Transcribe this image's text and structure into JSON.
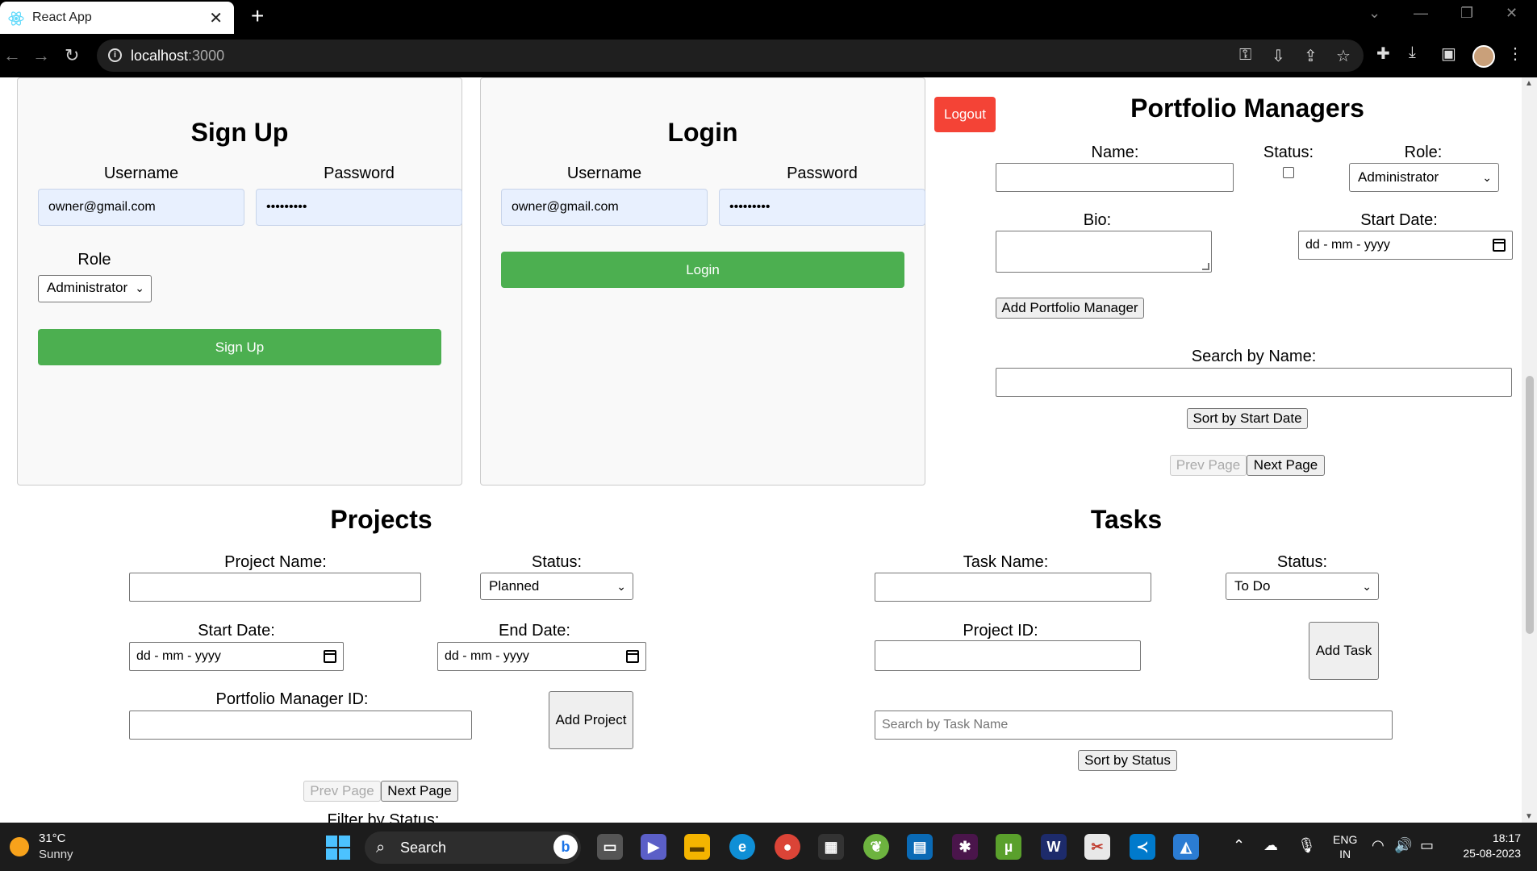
{
  "browser": {
    "tab_title": "React App",
    "url_host": "localhost",
    "url_port": ":3000"
  },
  "signup": {
    "heading": "Sign Up",
    "username_label": "Username",
    "password_label": "Password",
    "username_value": "owner@gmail.com",
    "password_value": "•••••••••",
    "role_label": "Role",
    "role_value": "Administrator",
    "button": "Sign Up"
  },
  "login": {
    "heading": "Login",
    "username_label": "Username",
    "password_label": "Password",
    "username_value": "owner@gmail.com",
    "password_value": "•••••••••",
    "button": "Login"
  },
  "portfolio": {
    "logout": "Logout",
    "heading": "Portfolio Managers",
    "name_label": "Name:",
    "status_label": "Status:",
    "role_label": "Role:",
    "role_value": "Administrator",
    "bio_label": "Bio:",
    "start_date_label": "Start Date:",
    "date_placeholder": "dd - mm - yyyy",
    "add_button": "Add Portfolio Manager",
    "search_label": "Search by Name:",
    "sort_button": "Sort by Start Date",
    "prev_button": "Prev Page",
    "next_button": "Next Page"
  },
  "projects": {
    "heading": "Projects",
    "name_label": "Project Name:",
    "status_label": "Status:",
    "status_value": "Planned",
    "start_label": "Start Date:",
    "end_label": "End Date:",
    "date_placeholder": "dd - mm - yyyy",
    "pm_id_label": "Portfolio Manager ID:",
    "add_button": "Add Project",
    "prev_button": "Prev Page",
    "next_button": "Next Page",
    "filter_label": "Filter by Status:"
  },
  "tasks": {
    "heading": "Tasks",
    "name_label": "Task Name:",
    "status_label": "Status:",
    "status_value": "To Do",
    "project_id_label": "Project ID:",
    "add_button": "Add Task",
    "search_placeholder": "Search by Task Name",
    "sort_button": "Sort by Status"
  },
  "taskbar": {
    "temperature": "31°C",
    "condition": "Sunny",
    "search_label": "Search",
    "lang_line1": "ENG",
    "lang_line2": "IN",
    "time": "18:17",
    "date": "25-08-2023"
  },
  "colors": {
    "accent_green": "#4caf50",
    "logout_red": "#f44336",
    "autofill_blue": "#e8f0fe"
  }
}
